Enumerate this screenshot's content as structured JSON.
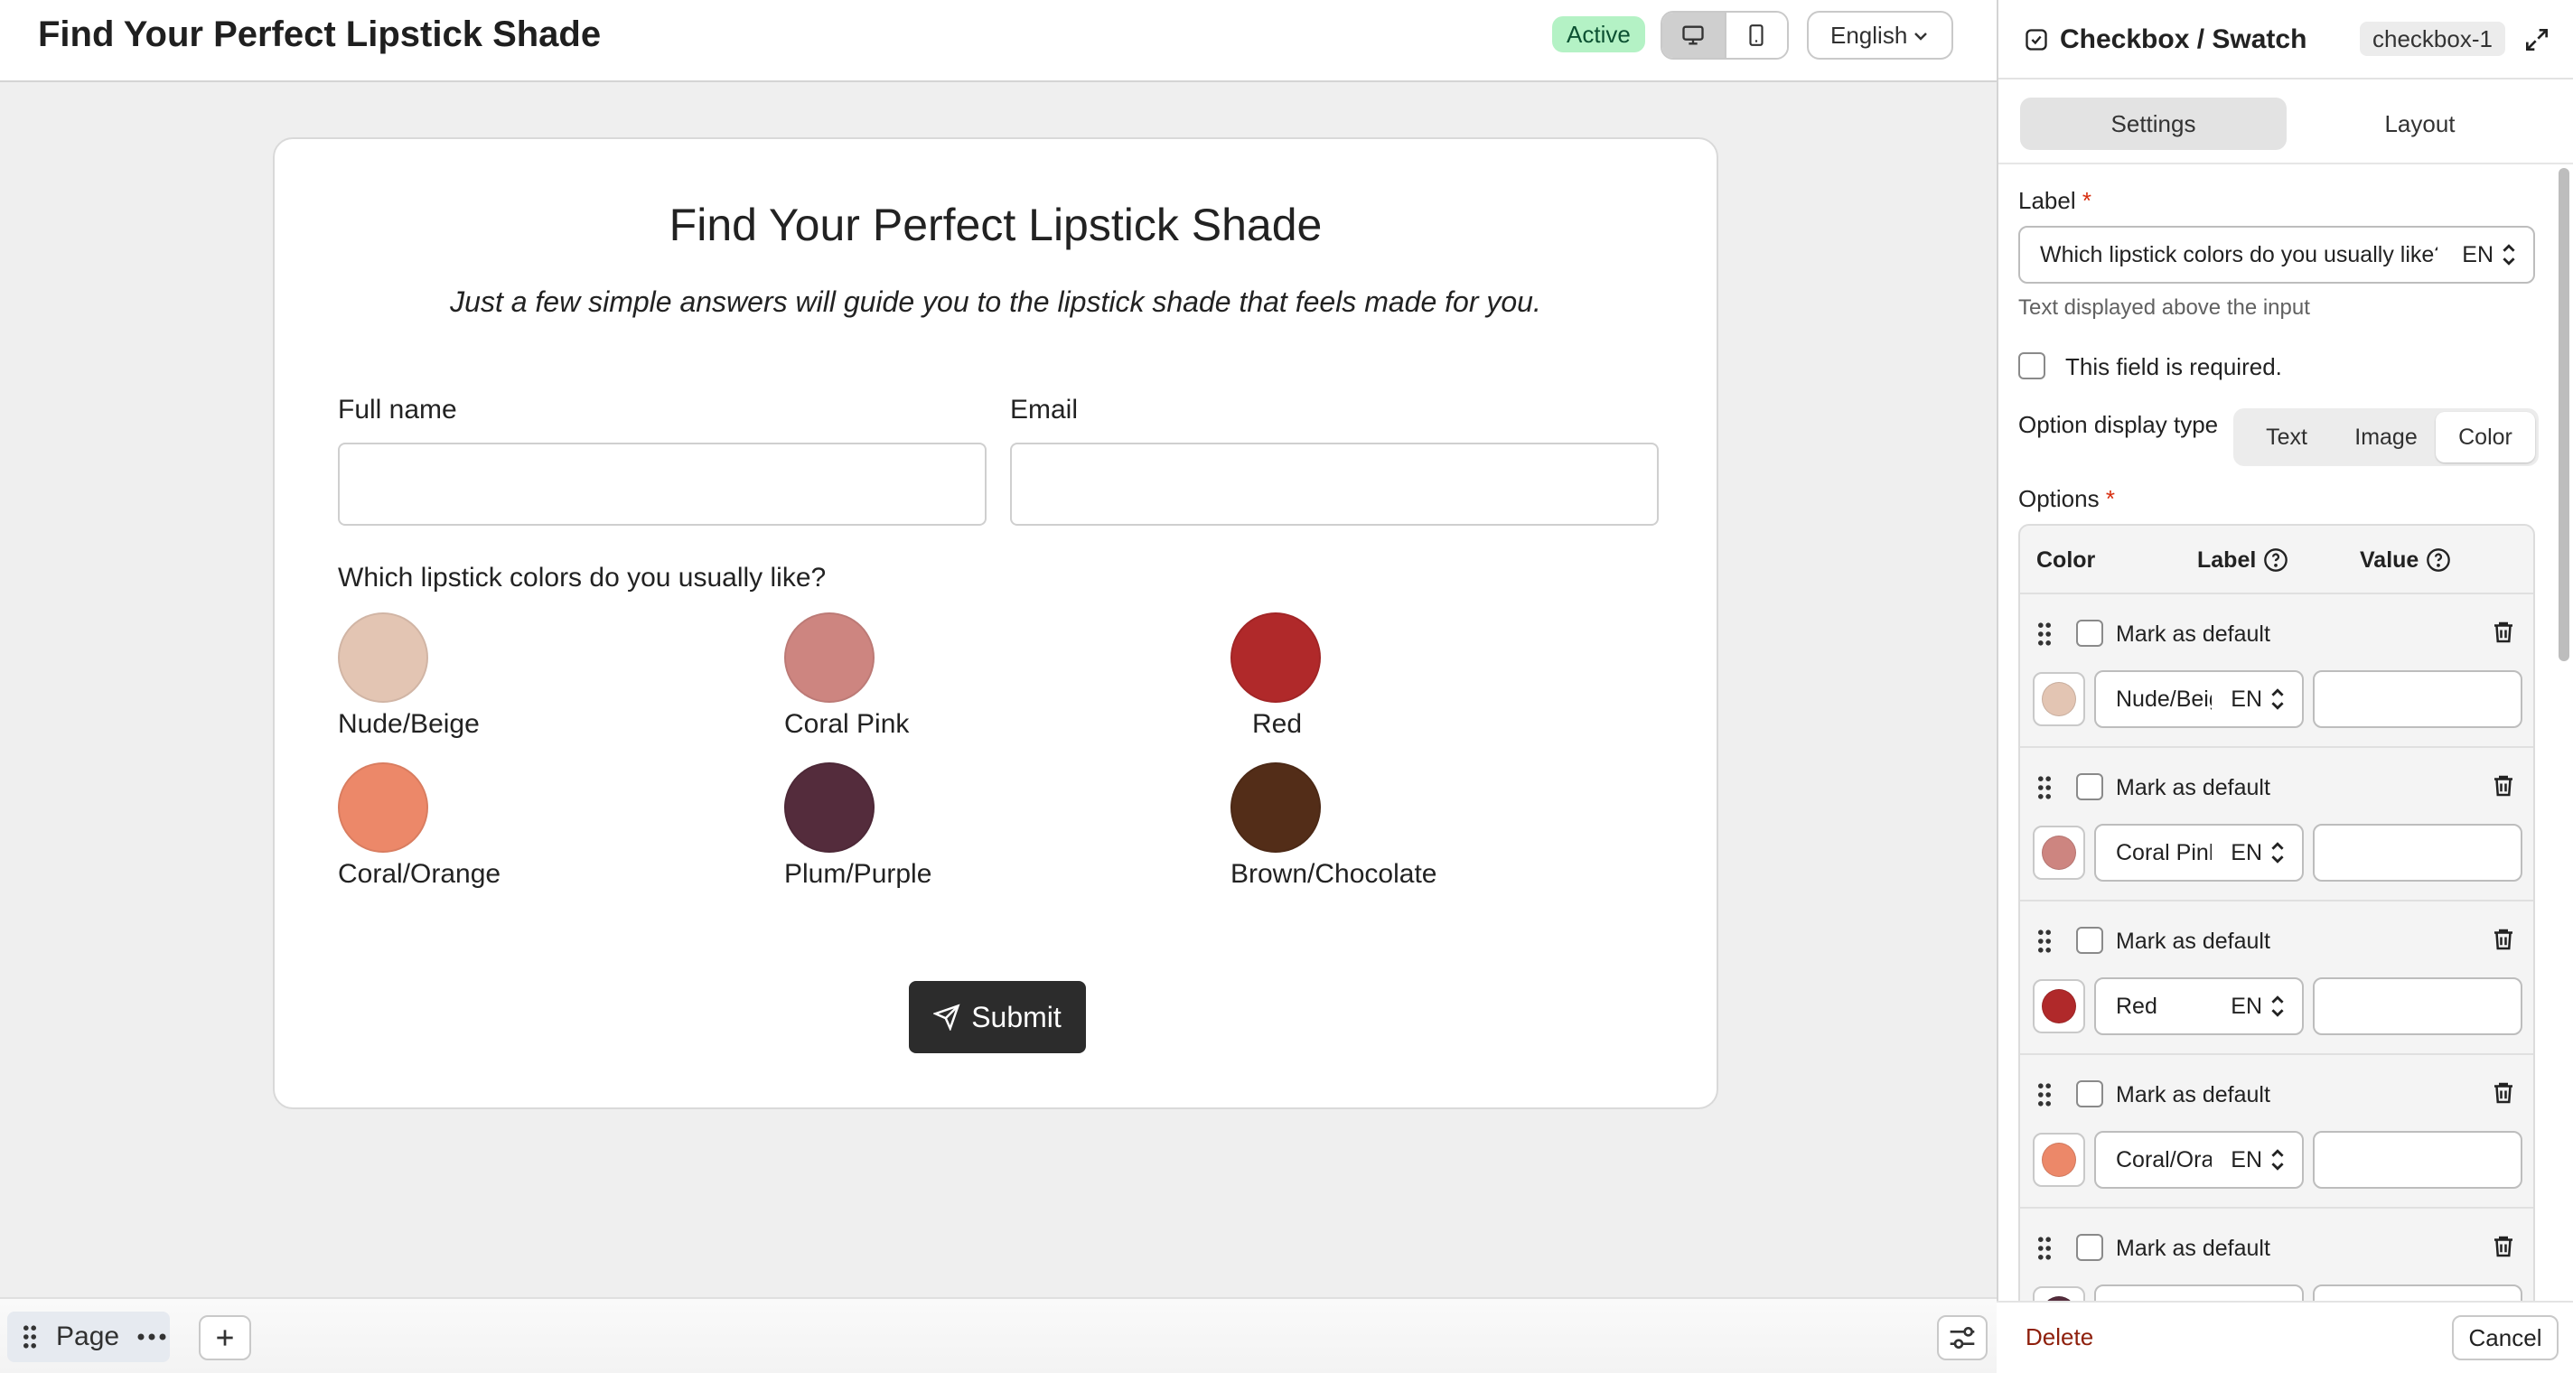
{
  "topbar": {
    "title": "Find Your Perfect Lipstick Shade",
    "status": "Active",
    "language": "English"
  },
  "form": {
    "title": "Find Your Perfect Lipstick Shade",
    "subtitle": "Just a few simple answers will guide you to the lipstick shade that feels made for you.",
    "full_name_label": "Full name",
    "email_label": "Email",
    "question": "Which lipstick colors do you usually like?",
    "swatches": [
      {
        "label": "Nude/Beige",
        "color": "#e3c5b3"
      },
      {
        "label": "Coral Pink",
        "color": "#cd8580"
      },
      {
        "label": "Red",
        "color": "#b0292a"
      },
      {
        "label": "Coral/Orange",
        "color": "#ec8869"
      },
      {
        "label": "Plum/Purple",
        "color": "#542c3c"
      },
      {
        "label": "Brown/Chocolate",
        "color": "#532d18"
      }
    ],
    "submit_label": "Submit"
  },
  "bottombar": {
    "page_label": "Page"
  },
  "panel": {
    "title": "Checkbox / Swatch",
    "element_id": "checkbox-1",
    "tabs": [
      "Settings",
      "Layout"
    ],
    "label_title": "Label",
    "label_value": "Which lipstick colors do you usually like?",
    "lang_code": "EN",
    "label_help": "Text displayed above the input",
    "required_text": "This field is required.",
    "display_type_label": "Option display type",
    "display_types": [
      "Text",
      "Image",
      "Color"
    ],
    "options_title": "Options",
    "col_color": "Color",
    "col_label": "Label",
    "col_value": "Value",
    "mark_default": "Mark as default",
    "options": [
      {
        "label": "Nude/Beige",
        "color": "#e3c5b3"
      },
      {
        "label": "Coral Pink",
        "color": "#cd8580"
      },
      {
        "label": "Red",
        "color": "#b0292a"
      },
      {
        "label": "Coral/Orange",
        "color": "#ec8869"
      },
      {
        "label": "",
        "color": "#542c3c"
      }
    ],
    "delete_label": "Delete",
    "cancel_label": "Cancel"
  },
  "colors": {
    "accent_dark": "#2c2c2c",
    "status_bg": "#b4f2c5",
    "danger": "#8e1f0b"
  }
}
